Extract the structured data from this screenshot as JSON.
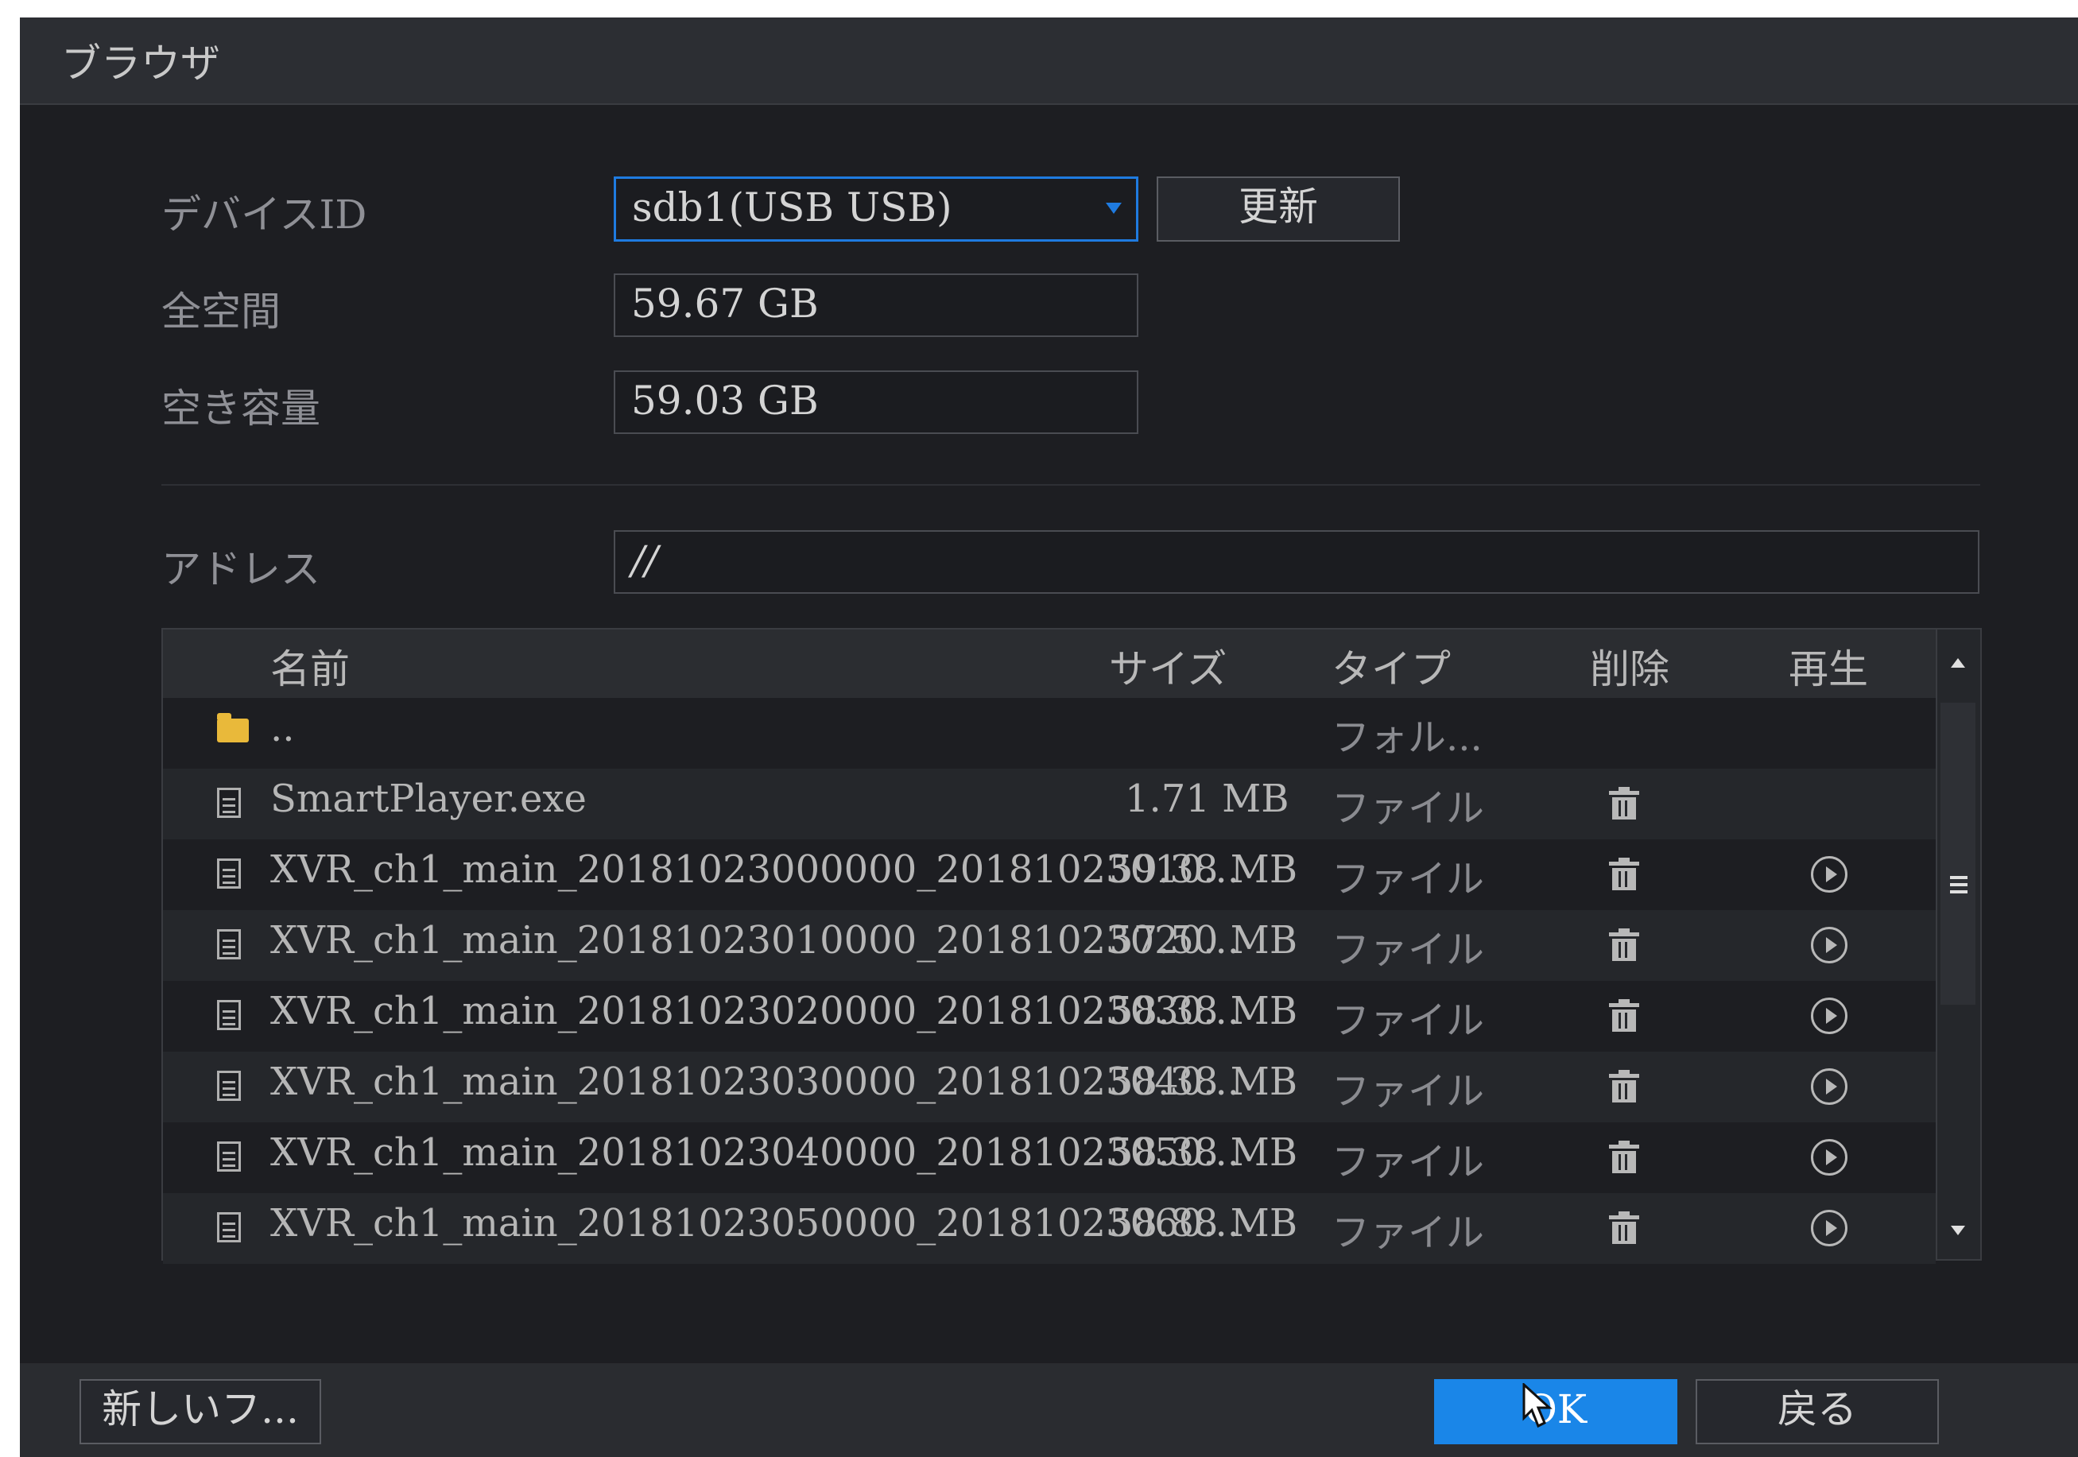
{
  "window": {
    "title": "ブラウザ"
  },
  "device": {
    "label": "デバイスID",
    "selected": "sdb1(USB USB)",
    "refresh_label": "更新"
  },
  "total_space": {
    "label": "全空間",
    "value": "59.67 GB"
  },
  "free_space": {
    "label": "空き容量",
    "value": "59.03 GB"
  },
  "address": {
    "label": "アドレス",
    "value": "//"
  },
  "table": {
    "columns": {
      "name": "名前",
      "size": "サイズ",
      "type": "タイプ",
      "delete": "削除",
      "play": "再生"
    },
    "rows": [
      {
        "icon": "folder-icon",
        "name": "..",
        "size": "",
        "type": "フォル...",
        "delete": false,
        "play": false
      },
      {
        "icon": "file-icon",
        "name": "SmartPlayer.exe",
        "size": "1.71 MB",
        "type": "ファイル",
        "delete": true,
        "play": false
      },
      {
        "icon": "file-icon",
        "name": "XVR_ch1_main_20181023000000_20181023010...",
        "size": "59.38 MB",
        "type": "ファイル",
        "delete": true,
        "play": true
      },
      {
        "icon": "file-icon",
        "name": "XVR_ch1_main_20181023010000_20181023020...",
        "size": "57.50 MB",
        "type": "ファイル",
        "delete": true,
        "play": true
      },
      {
        "icon": "file-icon",
        "name": "XVR_ch1_main_20181023020000_20181023030...",
        "size": "58.38 MB",
        "type": "ファイル",
        "delete": true,
        "play": true
      },
      {
        "icon": "file-icon",
        "name": "XVR_ch1_main_20181023030000_20181023040...",
        "size": "58.38 MB",
        "type": "ファイル",
        "delete": true,
        "play": true
      },
      {
        "icon": "file-icon",
        "name": "XVR_ch1_main_20181023040000_20181023050...",
        "size": "58.38 MB",
        "type": "ファイル",
        "delete": true,
        "play": true
      },
      {
        "icon": "file-icon",
        "name": "XVR_ch1_main_20181023050000_20181023060...",
        "size": "58.88 MB",
        "type": "ファイル",
        "delete": true,
        "play": true
      }
    ]
  },
  "footer": {
    "new_folder_label": "新しいフ...",
    "ok_label": "OK",
    "back_label": "戻る"
  },
  "colors": {
    "accent": "#1a86e8",
    "background": "#1d1e22",
    "folder": "#e9b93a"
  }
}
